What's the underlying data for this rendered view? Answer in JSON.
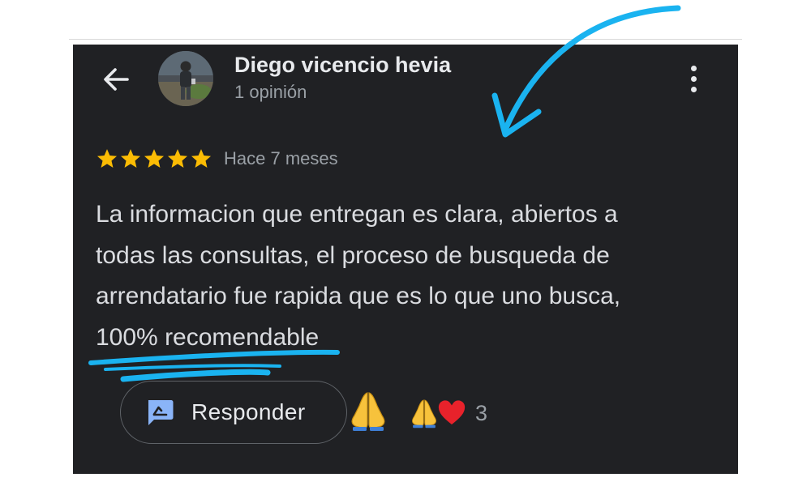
{
  "reviewer": {
    "name": "Diego vicencio hevia",
    "review_count": "1 opinión"
  },
  "review": {
    "rating": 5,
    "max_rating": 5,
    "date": "Hace 7 meses",
    "lines": [
      "La informacion que entregan es clara, abiertos a",
      "todas las consultas, el proceso de busqueda de",
      "arrendatario fue rapida que es lo que uno busca,",
      "100% recomendable"
    ]
  },
  "actions": {
    "reply_label": "Responder",
    "reaction_count": "3"
  },
  "icons": {
    "back": "back-arrow-icon",
    "more": "more-vert-icon",
    "star": "star-icon",
    "reply": "reply-icon",
    "pray": "folded-hands-icon",
    "heart": "heart-icon"
  },
  "colors": {
    "card_background": "#202124",
    "star": "#fbbc04",
    "reply_icon": "#8ab4f8",
    "annotation": "#1ab3f0"
  }
}
